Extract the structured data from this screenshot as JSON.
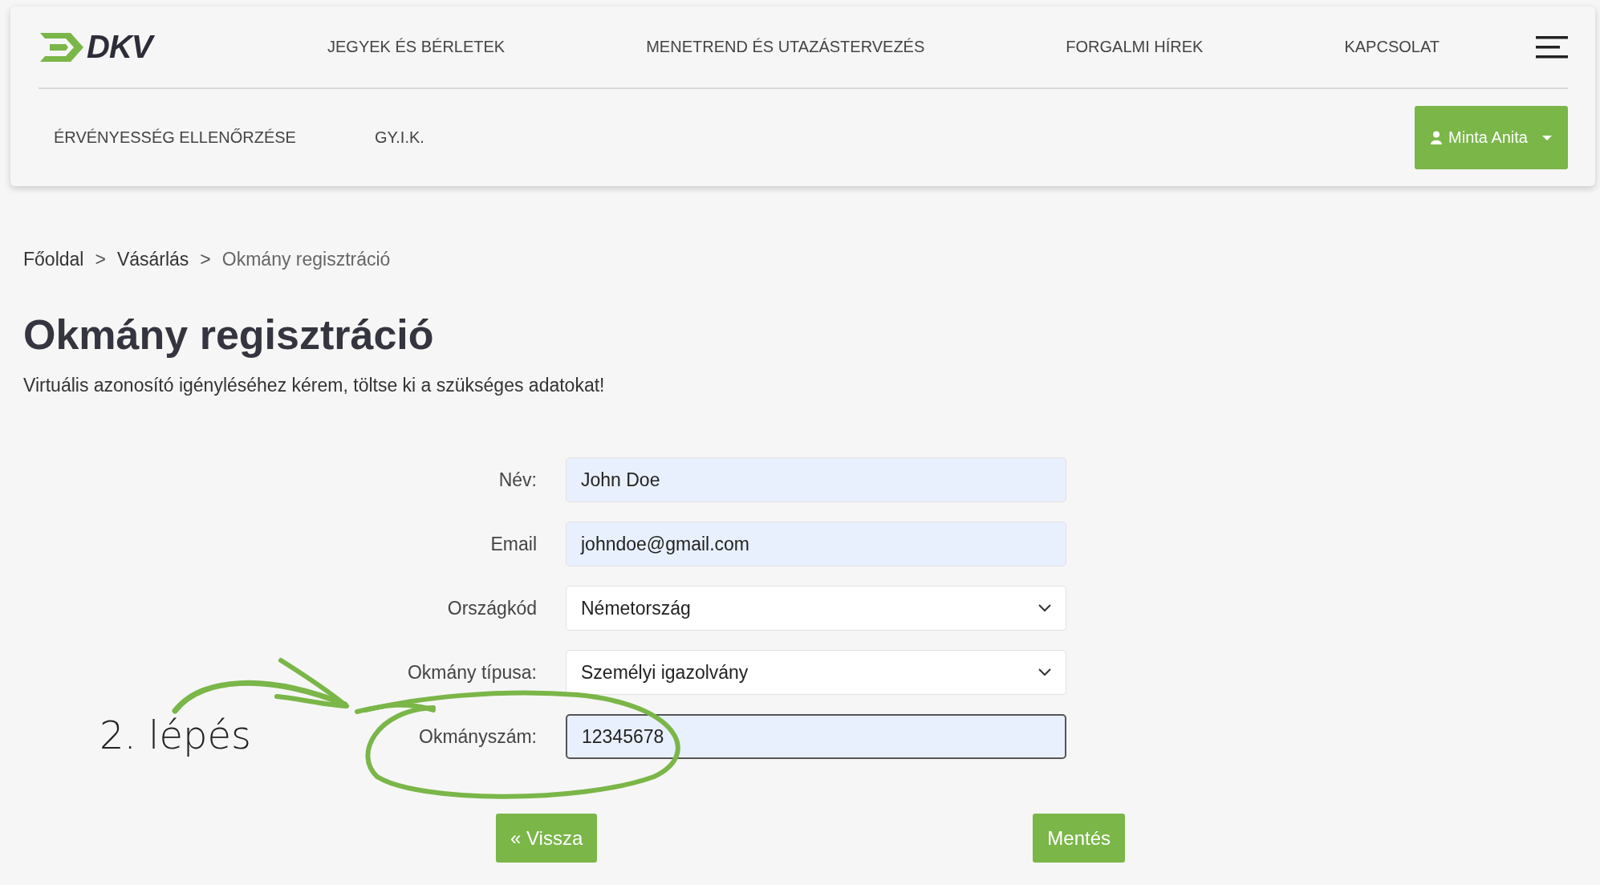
{
  "header": {
    "logo": "DKV",
    "nav": [
      "JEGYEK ÉS BÉRLETEK",
      "MENETREND ÉS UTAZÁSTERVEZÉS",
      "FORGALMI HÍREK",
      "KAPCSOLAT"
    ],
    "subnav": [
      "ÉRVÉNYESSÉG ELLENŐRZÉSE",
      "GY.I.K."
    ],
    "user_button": "Minta Anita"
  },
  "breadcrumb": [
    {
      "label": "Főoldal",
      "current": false
    },
    {
      "label": "Vásárlás",
      "current": false
    },
    {
      "label": "Okmány regisztráció",
      "current": true
    }
  ],
  "breadcrumb_separator": ">",
  "title": "Okmány regisztráció",
  "subtitle": "Virtuális azonosító igényléséhez kérem, töltse ki a szükséges adatokat!",
  "form": [
    {
      "label": "Név:",
      "kind": "input",
      "value": "John Doe",
      "autofilled": true,
      "focused": false
    },
    {
      "label": "Email",
      "kind": "input",
      "value": "johndoe@gmail.com",
      "autofilled": true,
      "focused": false
    },
    {
      "label": "Országkód",
      "kind": "select",
      "value": "Németország",
      "autofilled": false,
      "focused": false
    },
    {
      "label": "Okmány típusa:",
      "kind": "select",
      "value": "Személyi igazolvány",
      "autofilled": false,
      "focused": false
    },
    {
      "label": "Okmányszám:",
      "kind": "input",
      "value": "12345678",
      "autofilled": true,
      "focused": true
    }
  ],
  "buttons": {
    "back": "« Vissza",
    "save": "Mentés"
  },
  "annotation": {
    "text": "2. lépés"
  }
}
